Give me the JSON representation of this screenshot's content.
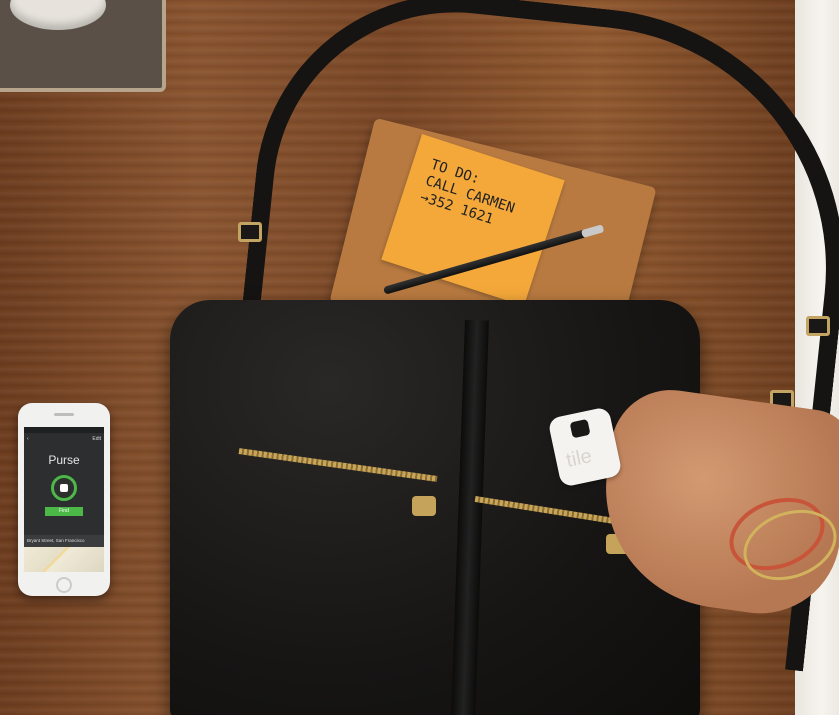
{
  "sticky_note": {
    "text": "TO DO:\nCALL CARMEN\n→352 1621"
  },
  "tile_tracker": {
    "brand": "tile"
  },
  "phone_app": {
    "back_label": "‹",
    "edit_label": "Edit",
    "title": "Purse",
    "find_button": "Find",
    "location": "Bryant Street, San Francisco"
  },
  "colors": {
    "app_green": "#4cb848",
    "table_wood": "#7a4726",
    "bag_leather": "#161514",
    "sticky_note": "#f4a83a"
  }
}
